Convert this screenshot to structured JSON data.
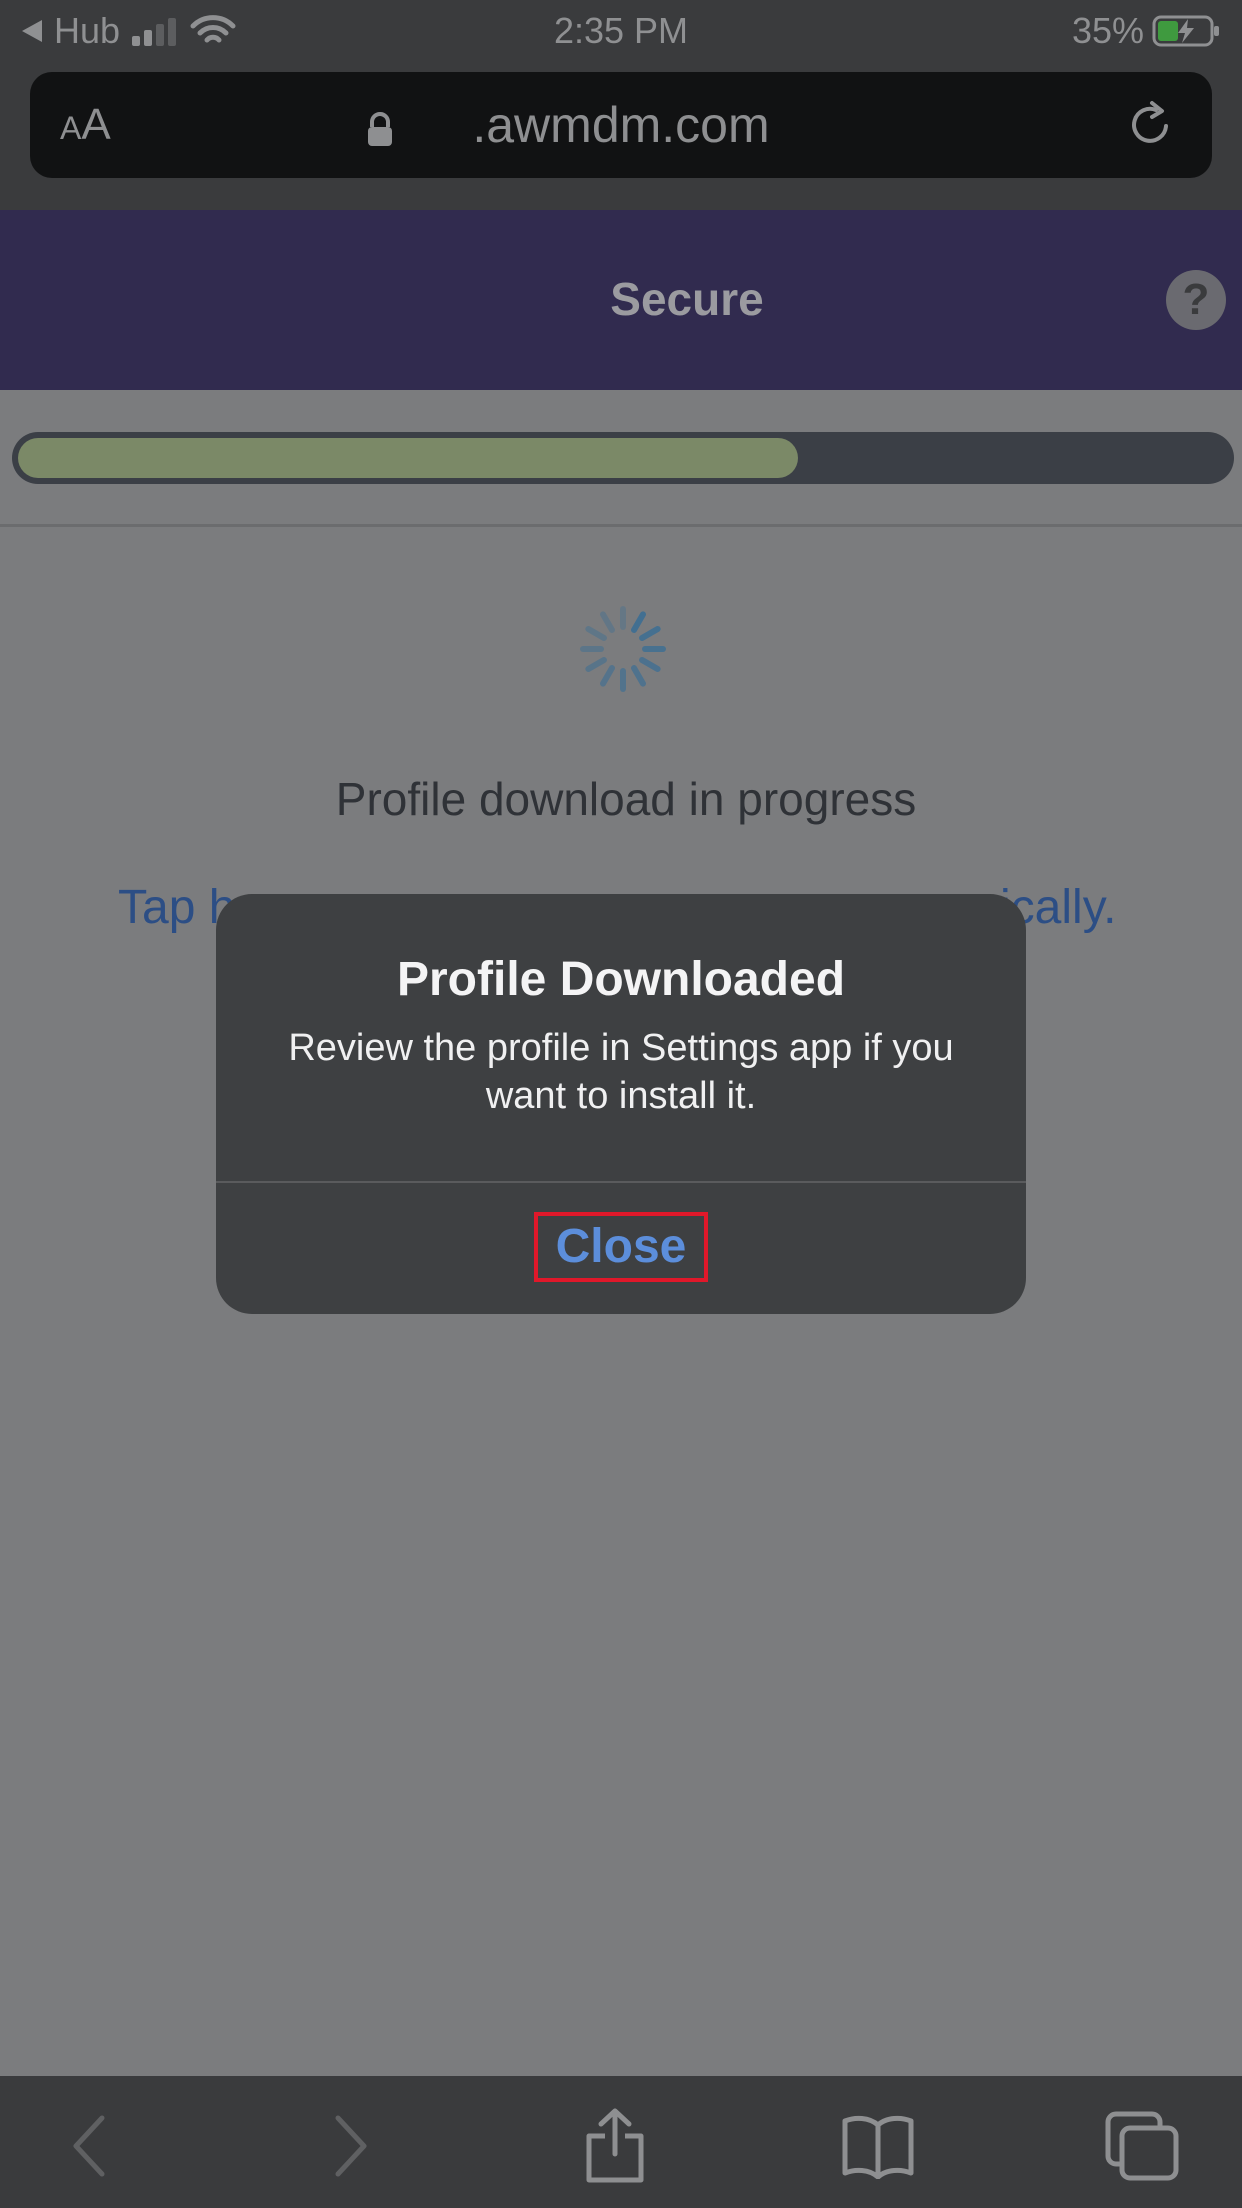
{
  "status_bar": {
    "back_app": "Hub",
    "time": "2:35 PM",
    "battery": "35%",
    "icons": [
      "back-arrow-icon",
      "signal-icon",
      "wifi-icon",
      "battery-charging-icon"
    ]
  },
  "browser": {
    "text_size_label_small": "A",
    "text_size_label_large": "A",
    "url": ".awmdm.com",
    "icons": [
      "lock-icon",
      "reload-icon"
    ]
  },
  "header": {
    "title": "Secure",
    "help_label": "?"
  },
  "progress": {
    "fraction": 0.645
  },
  "content": {
    "status_text": "Profile download in progress",
    "link_text_start": "Tap h",
    "link_text_end": "ically."
  },
  "alert": {
    "title": "Profile Downloaded",
    "message": "Review the profile in Settings app if you want to install it.",
    "close_label": "Close"
  },
  "toolbar": {
    "icons": [
      "back-chevron-icon",
      "forward-chevron-icon",
      "share-icon",
      "bookmarks-icon",
      "tabs-icon"
    ]
  },
  "colors": {
    "header_bg": "#312b4f",
    "progress_fill": "#7b8967",
    "link": "#2c4e85",
    "alert_button": "#5c8edb",
    "highlight_border": "#e0182a"
  }
}
